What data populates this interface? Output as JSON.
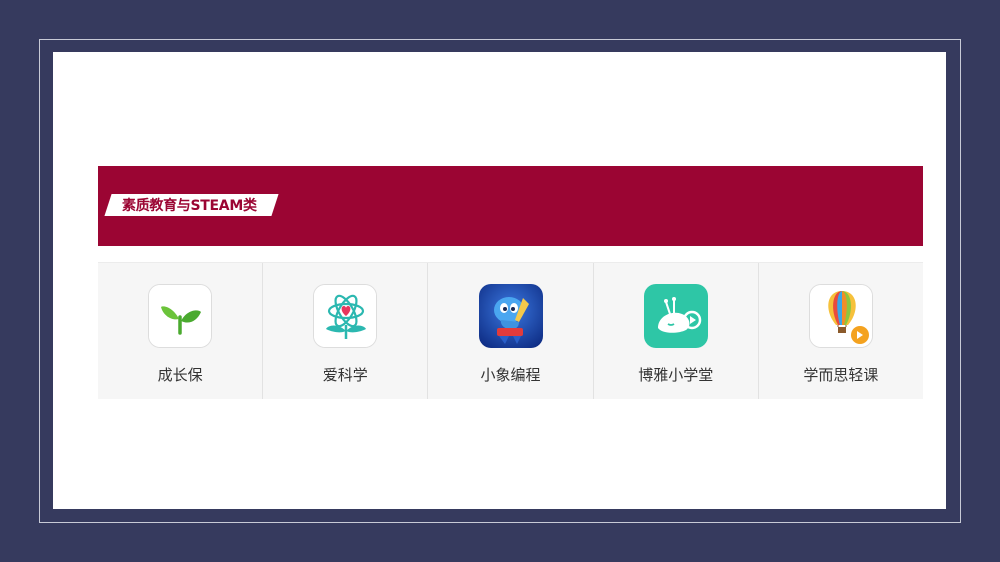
{
  "section": {
    "title": "素质教育与STEAM类"
  },
  "apps": [
    {
      "label": "成长保",
      "icon": "sprout-icon"
    },
    {
      "label": "爱科学",
      "icon": "atom-heart-icon"
    },
    {
      "label": "小象编程",
      "icon": "robot-mascot-icon"
    },
    {
      "label": "博雅小学堂",
      "icon": "snail-play-icon"
    },
    {
      "label": "学而思轻课",
      "icon": "hot-air-balloon-icon"
    }
  ],
  "colors": {
    "background": "#363a5e",
    "banner": "#9b0533",
    "slide": "#ffffff"
  }
}
